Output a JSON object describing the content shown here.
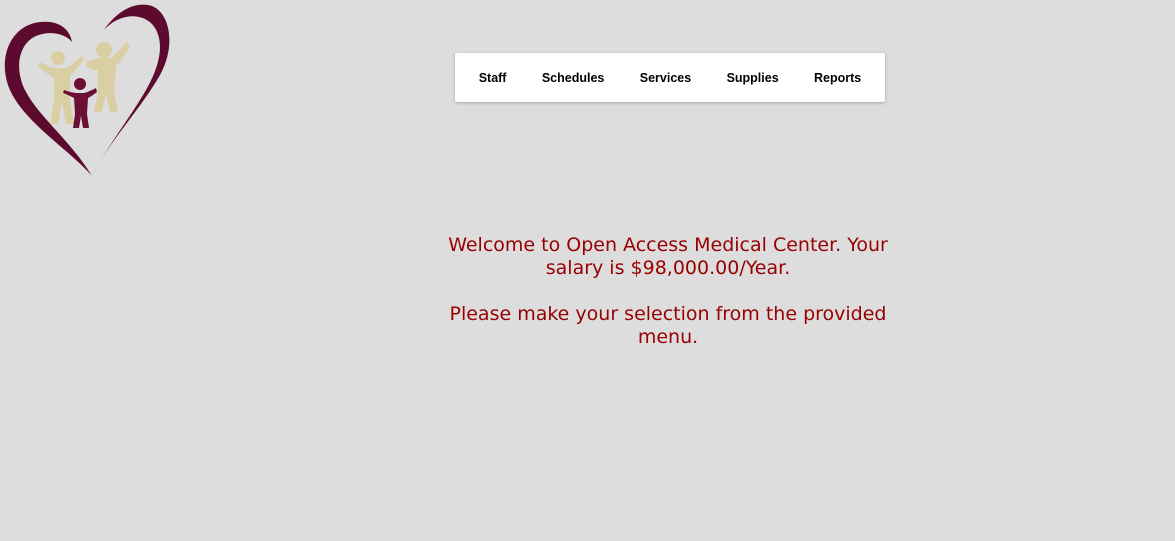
{
  "brand": {
    "logo_icon": "heart-family-logo-icon",
    "colors": {
      "heart": "#5c0a2e",
      "figures_light": "#d9cfa3",
      "figures_dark": "#6b0f35"
    }
  },
  "menu": {
    "items": [
      {
        "label": "Staff"
      },
      {
        "label": "Schedules"
      },
      {
        "label": "Services"
      },
      {
        "label": "Supplies"
      },
      {
        "label": "Reports"
      }
    ]
  },
  "main": {
    "welcome_text": "Welcome to Open Access Medical Center. Your salary is $98,000.00/Year.",
    "instruction_text": "Please make your selection from the provided menu.",
    "text_color": "#990000"
  },
  "page": {
    "background": "#dddddd"
  }
}
